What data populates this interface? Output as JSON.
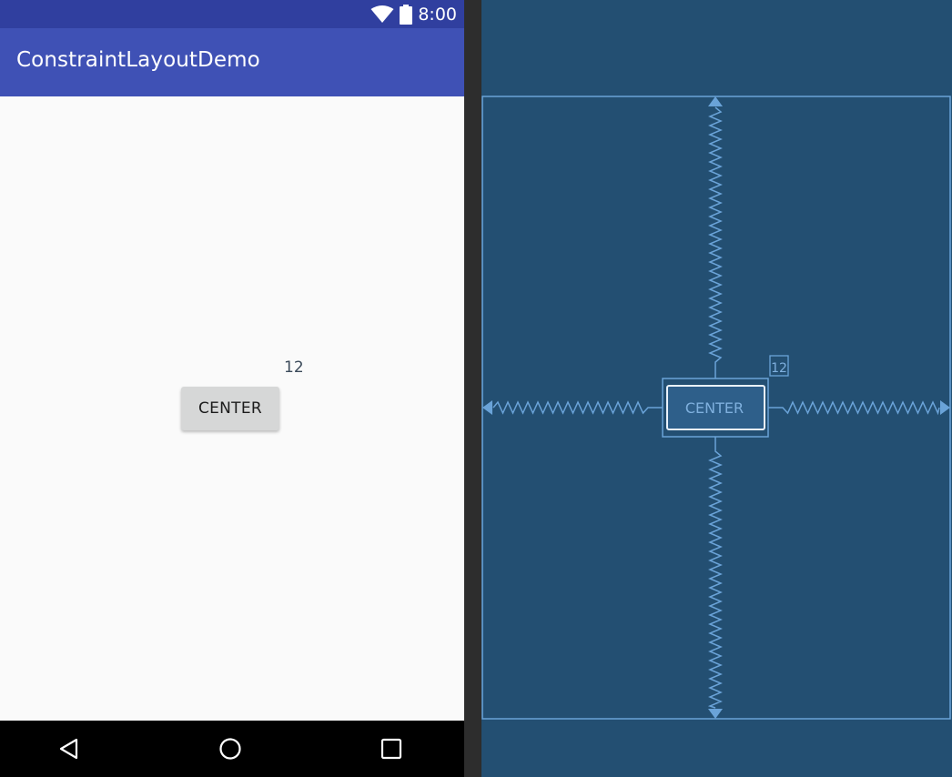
{
  "status_bar": {
    "time": "8:00",
    "icons": [
      "wifi-icon",
      "battery-icon"
    ]
  },
  "app_bar": {
    "title": "ConstraintLayoutDemo"
  },
  "content": {
    "button_label": "CENTER",
    "badge_value": "12"
  },
  "nav_bar": {
    "icons": [
      "back-icon",
      "home-icon",
      "recents-icon"
    ]
  },
  "blueprint": {
    "button_label": "CENTER",
    "badge_value": "12"
  },
  "colors": {
    "status_bar": "#303f9f",
    "app_bar": "#3f51b5",
    "blueprint_bg": "#234f72",
    "blueprint_line": "#6aa3d8"
  }
}
